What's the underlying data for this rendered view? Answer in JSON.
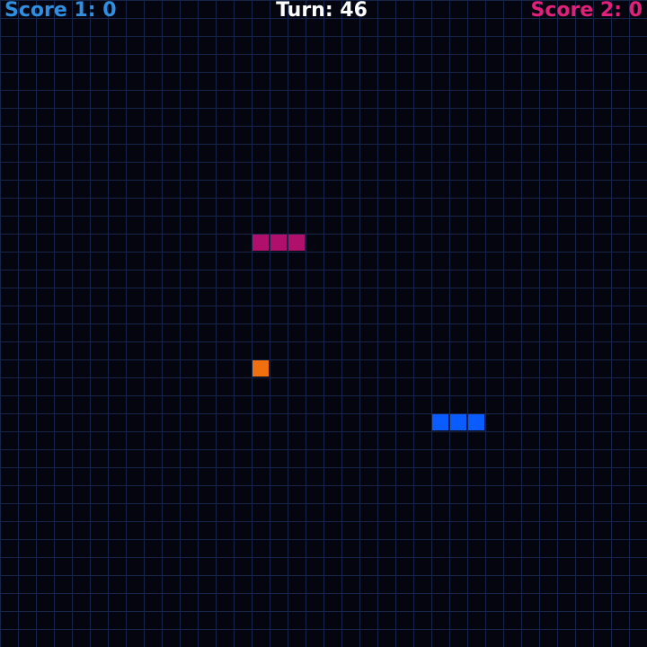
{
  "hud": {
    "score1_text": "Score 1: 0",
    "turn_text": "Turn: 46",
    "score2_text": "Score 2: 0"
  },
  "grid": {
    "columns": 36,
    "rows": 36
  },
  "colors": {
    "background": "#050510",
    "grid_line": "#16264a",
    "score1": "#2f8fe0",
    "score2": "#e0207a",
    "turn": "#ffffff",
    "snake1": "#0a5cff",
    "snake2": "#b0106c",
    "food": "#f07010"
  },
  "entities": {
    "snake1": {
      "name": "player-1-snake",
      "cells": [
        [
          24,
          23
        ],
        [
          25,
          23
        ],
        [
          26,
          23
        ]
      ]
    },
    "snake2": {
      "name": "player-2-snake",
      "cells": [
        [
          14,
          13
        ],
        [
          15,
          13
        ],
        [
          16,
          13
        ]
      ]
    },
    "food": {
      "name": "food",
      "cells": [
        [
          14,
          20
        ]
      ]
    }
  }
}
